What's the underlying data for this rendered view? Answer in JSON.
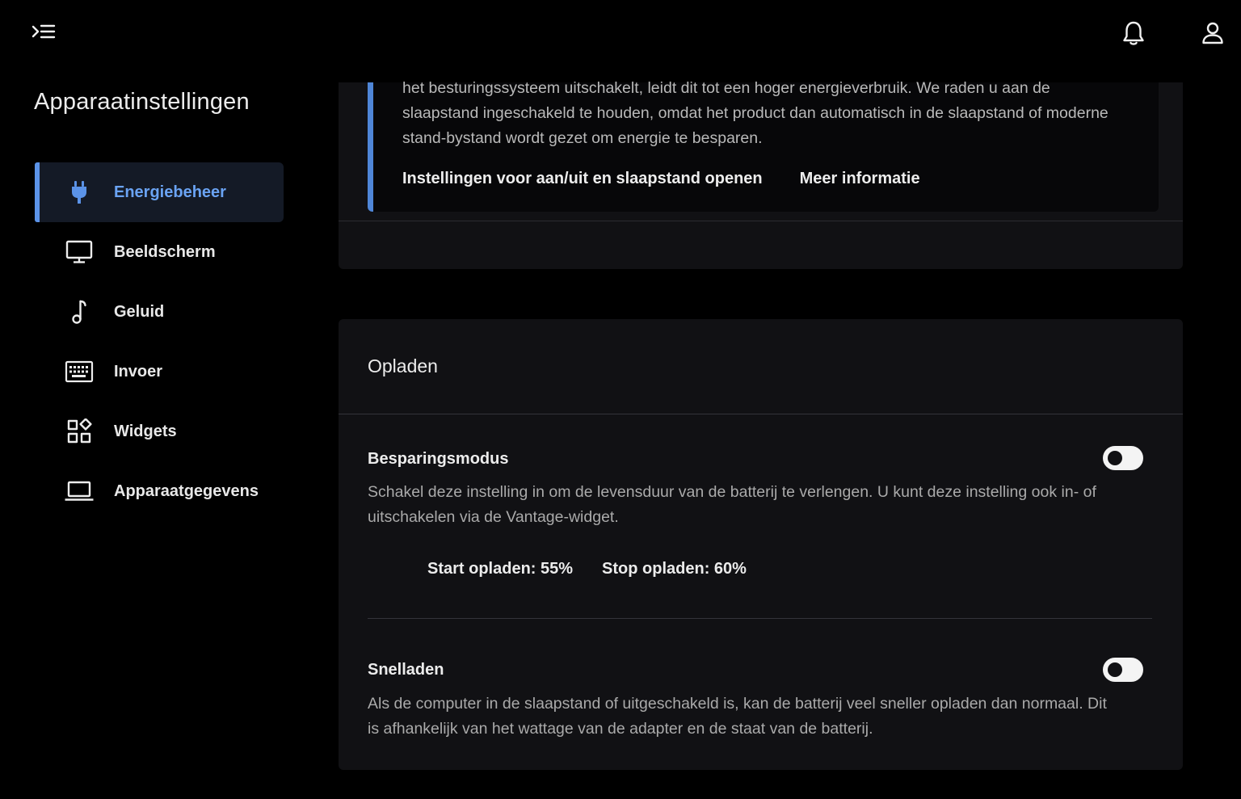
{
  "header": {
    "menu_icon": "menu-collapse-icon",
    "bell_icon": "bell-icon",
    "user_icon": "user-icon"
  },
  "sidebar": {
    "title": "Apparaatinstellingen",
    "items": [
      {
        "label": "Energiebeheer",
        "icon": "plug-icon",
        "active": true
      },
      {
        "label": "Beeldscherm",
        "icon": "monitor-icon",
        "active": false
      },
      {
        "label": "Geluid",
        "icon": "music-note-icon",
        "active": false
      },
      {
        "label": "Invoer",
        "icon": "keyboard-icon",
        "active": false
      },
      {
        "label": "Widgets",
        "icon": "widgets-icon",
        "active": false
      },
      {
        "label": "Apparaatgegevens",
        "icon": "laptop-icon",
        "active": false
      }
    ]
  },
  "notice": {
    "text": "het besturingssysteem uitschakelt, leidt dit tot een hoger energieverbruik. We raden u aan de slaapstand ingeschakeld te houden, omdat het product dan automatisch in de slaapstand of moderne stand-bystand wordt gezet om energie te besparen.",
    "link_power": "Instellingen voor aan/uit en slaapstand openen",
    "link_more": "Meer informatie"
  },
  "charging": {
    "title": "Opladen",
    "saving": {
      "title": "Besparingsmodus",
      "description": "Schakel deze instelling in om de levensduur van de batterij te verlengen. U kunt deze instelling ook in- of uitschakelen via de Vantage-widget.",
      "start_label": "Start opladen: 55%",
      "stop_label": "Stop opladen: 60%",
      "enabled": false
    },
    "fast": {
      "title": "Snelladen",
      "description": "Als de computer in de slaapstand of uitgeschakeld is, kan de batterij veel sneller opladen dan normaal. Dit is afhankelijk van het wattage van de adapter en de staat van de batterij.",
      "enabled": false
    }
  },
  "colors": {
    "accent": "#5b93e8",
    "active_text": "#6aa3f3",
    "card_bg": "#111114",
    "page_bg": "#000000"
  }
}
